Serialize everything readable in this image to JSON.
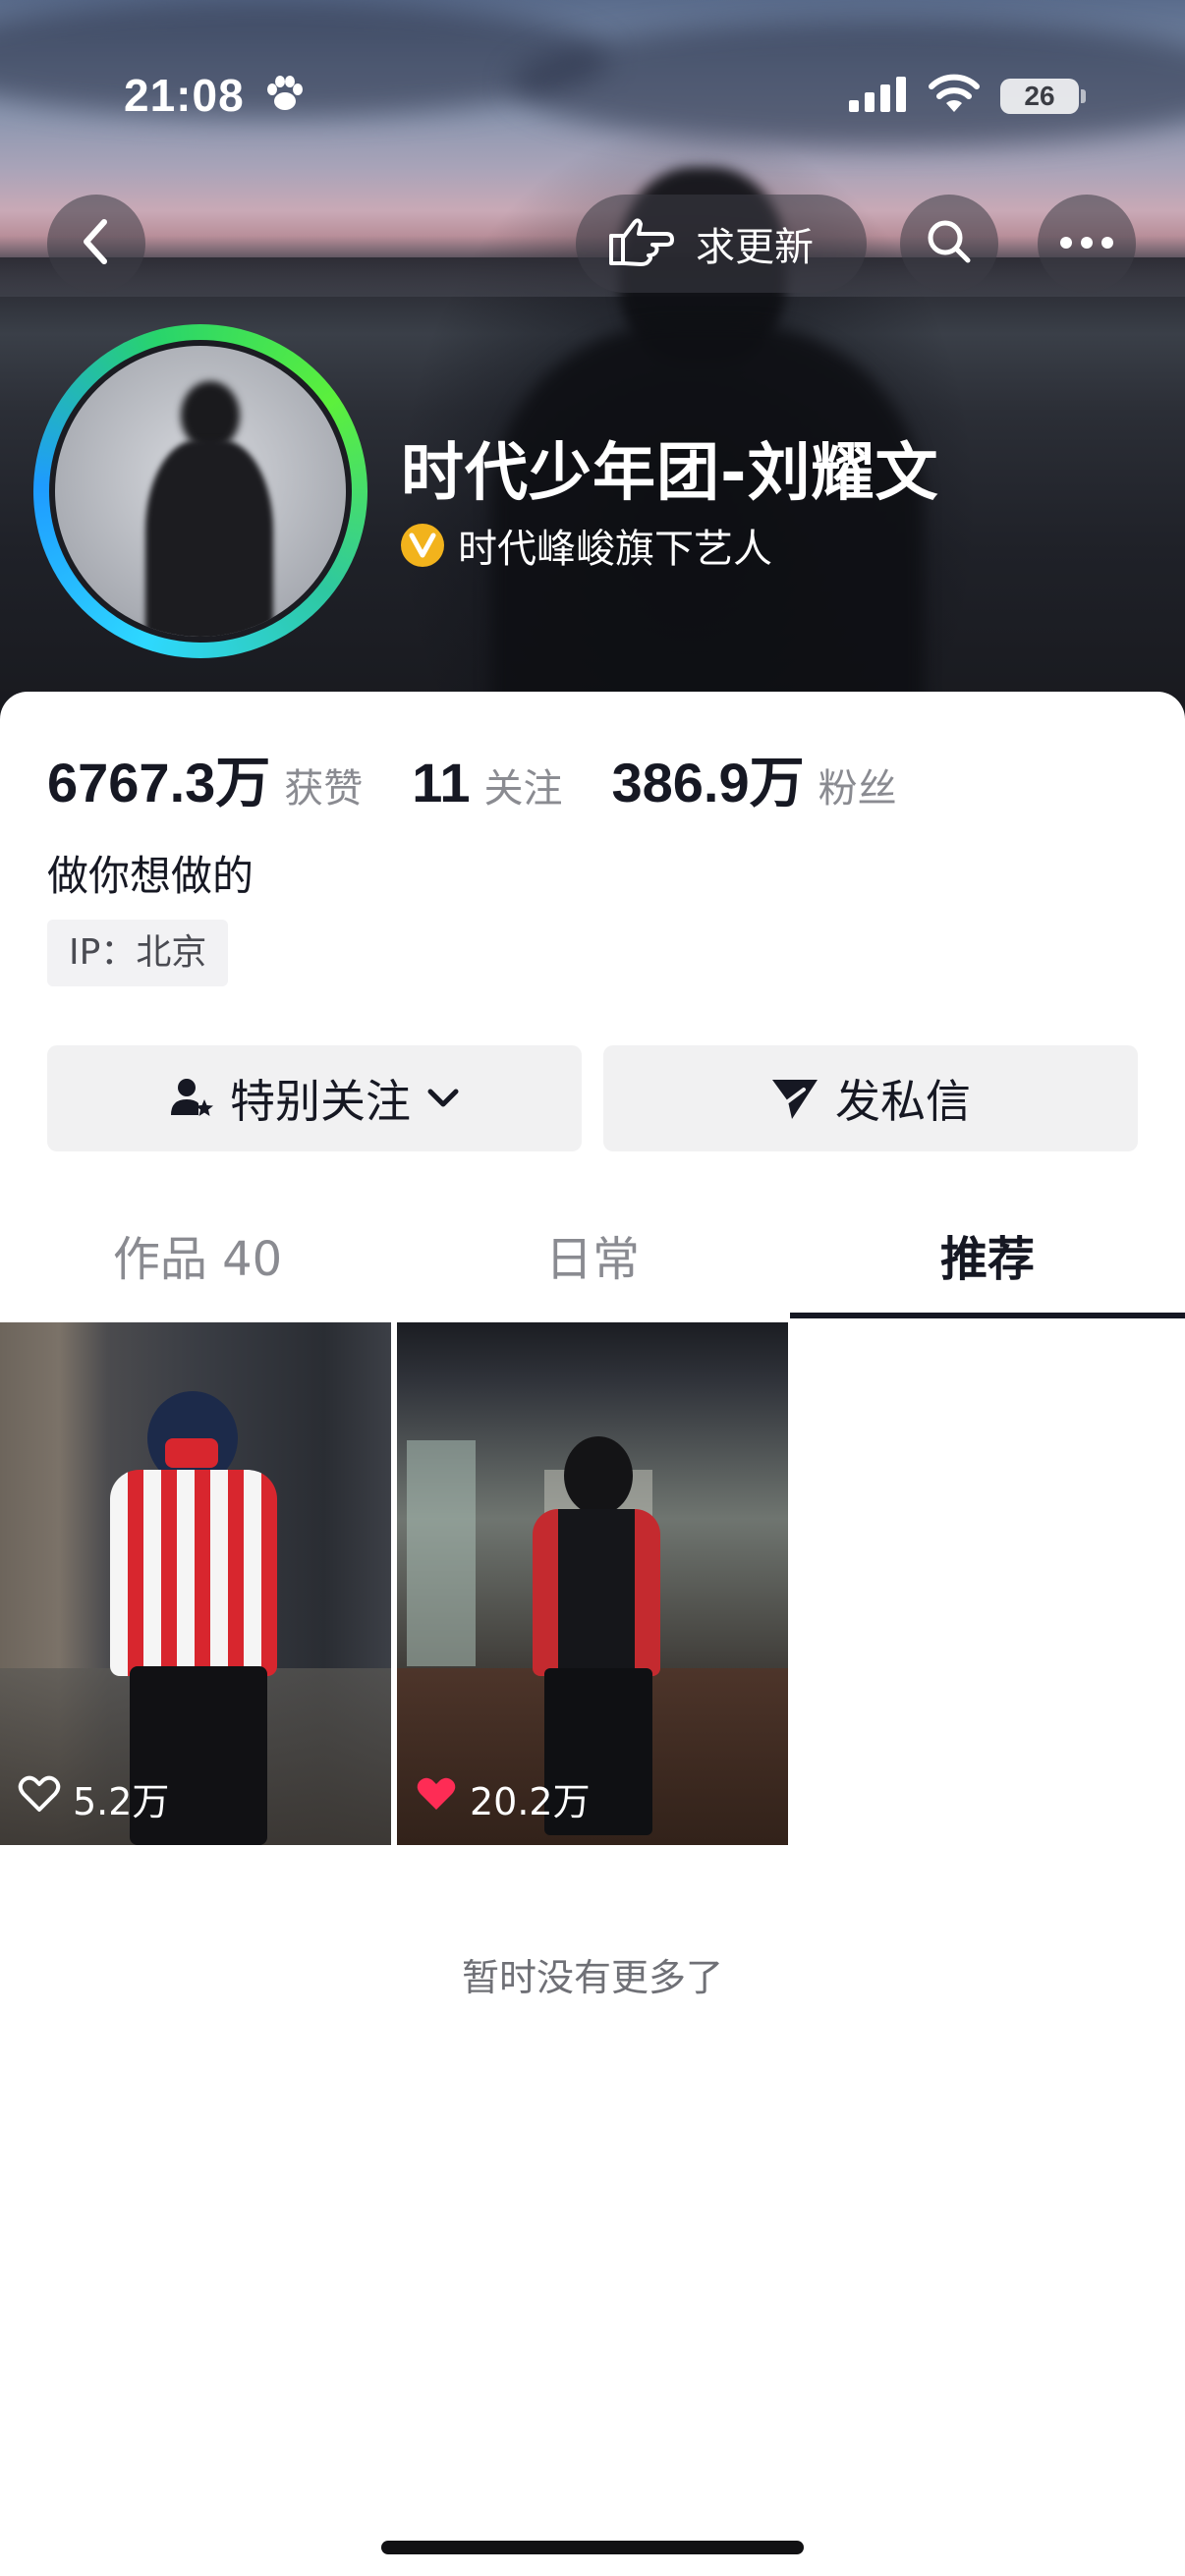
{
  "status_bar": {
    "time": "21:08",
    "battery": "26",
    "icons": [
      "paw-icon",
      "signal-icon",
      "wifi-icon",
      "battery-icon"
    ]
  },
  "header": {
    "back_icon": "chevron-left-icon",
    "request_update_label": "求更新",
    "request_update_icon": "pointing-hand-icon",
    "search_icon": "search-icon",
    "more_icon": "more-dots-icon"
  },
  "profile": {
    "display_name": "时代少年团-刘耀文",
    "verification_text": "时代峰峻旗下艺人",
    "verification_badge": "V",
    "bio": "做你想做的",
    "ip_location": "IP：北京"
  },
  "stats": [
    {
      "value": "6767.3万",
      "label": "获赞"
    },
    {
      "value": "11",
      "label": "关注"
    },
    {
      "value": "386.9万",
      "label": "粉丝"
    }
  ],
  "actions": {
    "follow_label": "特别关注",
    "message_label": "发私信"
  },
  "tabs": [
    {
      "label": "作品 40",
      "active": false
    },
    {
      "label": "日常",
      "active": false
    },
    {
      "label": "推荐",
      "active": true
    }
  ],
  "videos": [
    {
      "likes": "5.2万",
      "liked": false
    },
    {
      "likes": "20.2万",
      "liked": true
    }
  ],
  "end_message": "暂时没有更多了",
  "colors": {
    "accent_like": "#fe2c55",
    "verify_badge": "#f2b31c",
    "text_primary": "#161823",
    "text_secondary": "#8a8b91"
  }
}
